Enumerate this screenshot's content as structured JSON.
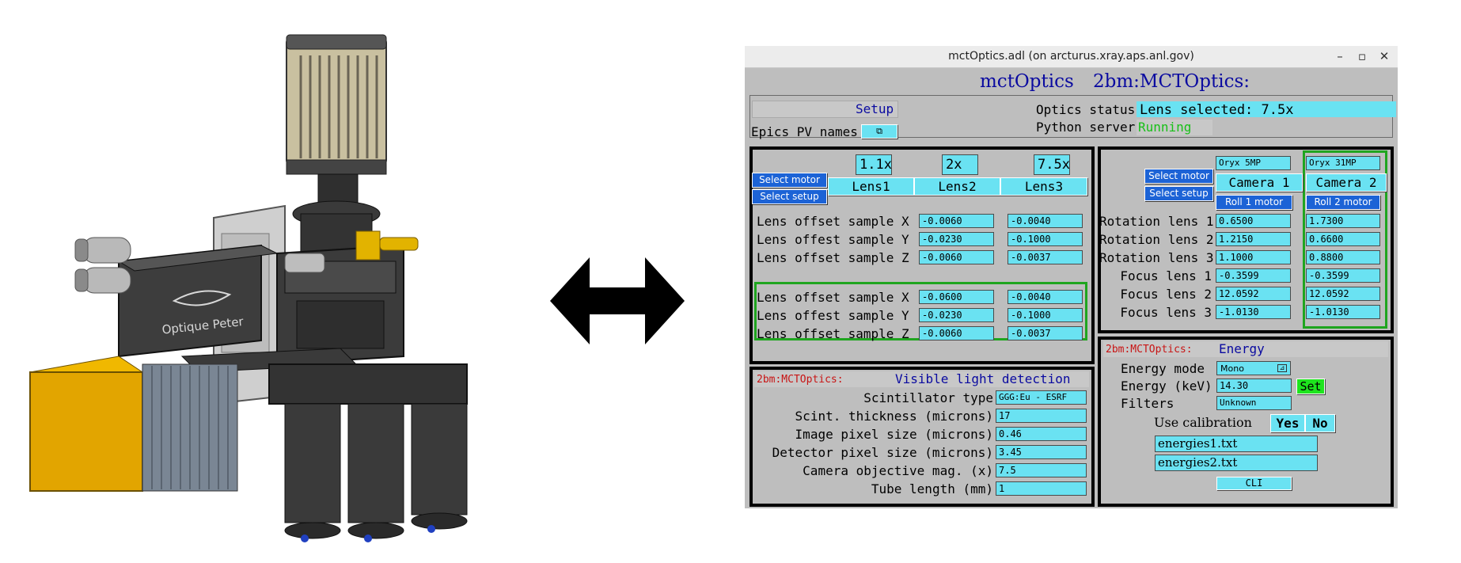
{
  "window": {
    "title": "mctOptics.adl (on arcturus.xray.aps.anl.gov)",
    "controls": [
      "–",
      "▫",
      "✕"
    ]
  },
  "header": {
    "app_name": "mctOptics",
    "prefix": "2bm:MCTOptics:"
  },
  "top": {
    "setup_label": "Setup",
    "epics_pv_label": "Epics PV names",
    "epics_pv_button": "⧉",
    "optics_status_label": "Optics status",
    "optics_status_value": "Lens selected: 7.5x",
    "python_server_label": "Python server",
    "python_server_value": "Running"
  },
  "lens_panel": {
    "magnifications": [
      "1.1x",
      "2x",
      "7.5x"
    ],
    "select_motor": "Select motor",
    "select_setup": "Select setup",
    "lens_buttons": [
      "Lens1",
      "Lens2",
      "Lens3"
    ],
    "rows": [
      {
        "label": "Lens offset sample X",
        "v1": "-0.0060",
        "v2": "-0.0040"
      },
      {
        "label": "Lens offest sample Y",
        "v1": "-0.0230",
        "v2": "-0.1000"
      },
      {
        "label": "Lens offset sample Z",
        "v1": "-0.0060",
        "v2": "-0.0037"
      }
    ],
    "rows_green": [
      {
        "label": "Lens offset sample X",
        "v1": "-0.0600",
        "v2": "-0.0040"
      },
      {
        "label": "Lens offest sample Y",
        "v1": "-0.0230",
        "v2": "-0.1000"
      },
      {
        "label": "Lens offset sample Z",
        "v1": "-0.0060",
        "v2": "-0.0037"
      }
    ]
  },
  "camera_panel": {
    "camera_models": [
      "Oryx 5MP",
      "Oryx 31MP"
    ],
    "select_motor": "Select motor",
    "select_setup": "Select setup",
    "camera_buttons": [
      "Camera 1",
      "Camera 2"
    ],
    "roll_buttons": [
      "Roll 1 motor",
      "Roll 2 motor"
    ],
    "rows": [
      {
        "label": "Rotation lens 1",
        "c1": "0.6500",
        "c2": "1.7300"
      },
      {
        "label": "Rotation lens 2",
        "c1": "1.2150",
        "c2": "0.6600"
      },
      {
        "label": "Rotation lens 3",
        "c1": "1.1000",
        "c2": "0.8800"
      },
      {
        "label": "Focus lens 1",
        "c1": "-0.3599",
        "c2": "-0.3599"
      },
      {
        "label": "Focus lens 2",
        "c1": "12.0592",
        "c2": "12.0592"
      },
      {
        "label": "Focus lens 3",
        "c1": "-1.0130",
        "c2": "-1.0130"
      }
    ]
  },
  "detection_panel": {
    "prefix": "2bm:MCTOptics:",
    "title": "Visible light detection",
    "rows": [
      {
        "label": "Scintillator type",
        "value": "GGG:Eu - ESRF"
      },
      {
        "label": "Scint. thickness (microns)",
        "value": "17"
      },
      {
        "label": "Image pixel size (microns)",
        "value": "0.46"
      },
      {
        "label": "Detector pixel size (microns)",
        "value": "3.45"
      },
      {
        "label": "Camera objective mag. (x)",
        "value": "7.5"
      },
      {
        "label": "Tube length (mm)",
        "value": "1"
      }
    ]
  },
  "energy_panel": {
    "prefix": "2bm:MCTOptics:",
    "title": "Energy",
    "energy_mode_label": "Energy mode",
    "energy_mode_value": "Mono",
    "energy_kev_label": "Energy (keV)",
    "energy_kev_value": "14.30",
    "set_label": "Set",
    "filters_label": "Filters",
    "filters_value": "Unknown",
    "use_calibration_label": "Use calibration",
    "yes_label": "Yes",
    "no_label": "No",
    "file1": "energies1.txt",
    "file2": "energies2.txt",
    "cli_label": "CLI"
  },
  "model": {
    "brand_label": "Optique Peter"
  }
}
